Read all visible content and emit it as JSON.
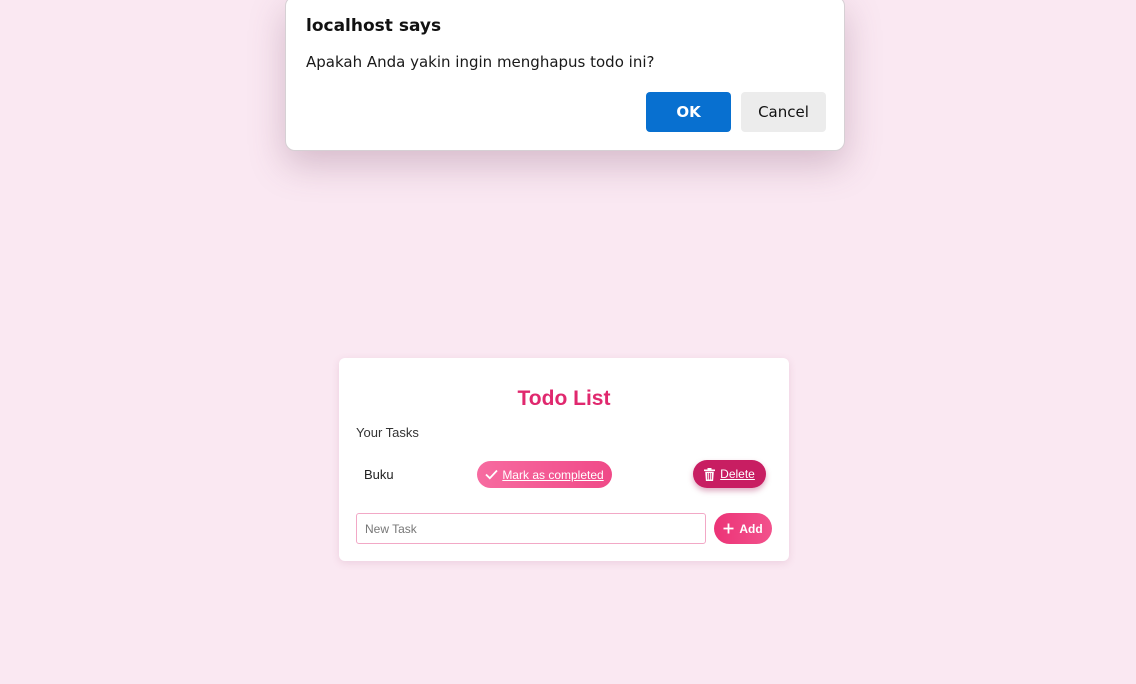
{
  "dialog": {
    "title": "localhost says",
    "message": "Apakah Anda yakin ingin menghapus todo ini?",
    "ok_label": "OK",
    "cancel_label": "Cancel"
  },
  "app": {
    "title": "Todo List",
    "section_label": "Your Tasks",
    "tasks": [
      {
        "name": "Buku",
        "complete_label": "Mark as completed",
        "delete_label": "Delete"
      }
    ],
    "input": {
      "placeholder": "New Task",
      "value": ""
    },
    "add_label": "Add"
  },
  "colors": {
    "page_background": "#fae8f2",
    "accent": "#e0286e",
    "delete_button": "#c81e62",
    "dialog_primary": "#0870d0"
  },
  "icons": {
    "complete": "check-icon",
    "delete": "trash-icon",
    "add": "plus-icon"
  }
}
